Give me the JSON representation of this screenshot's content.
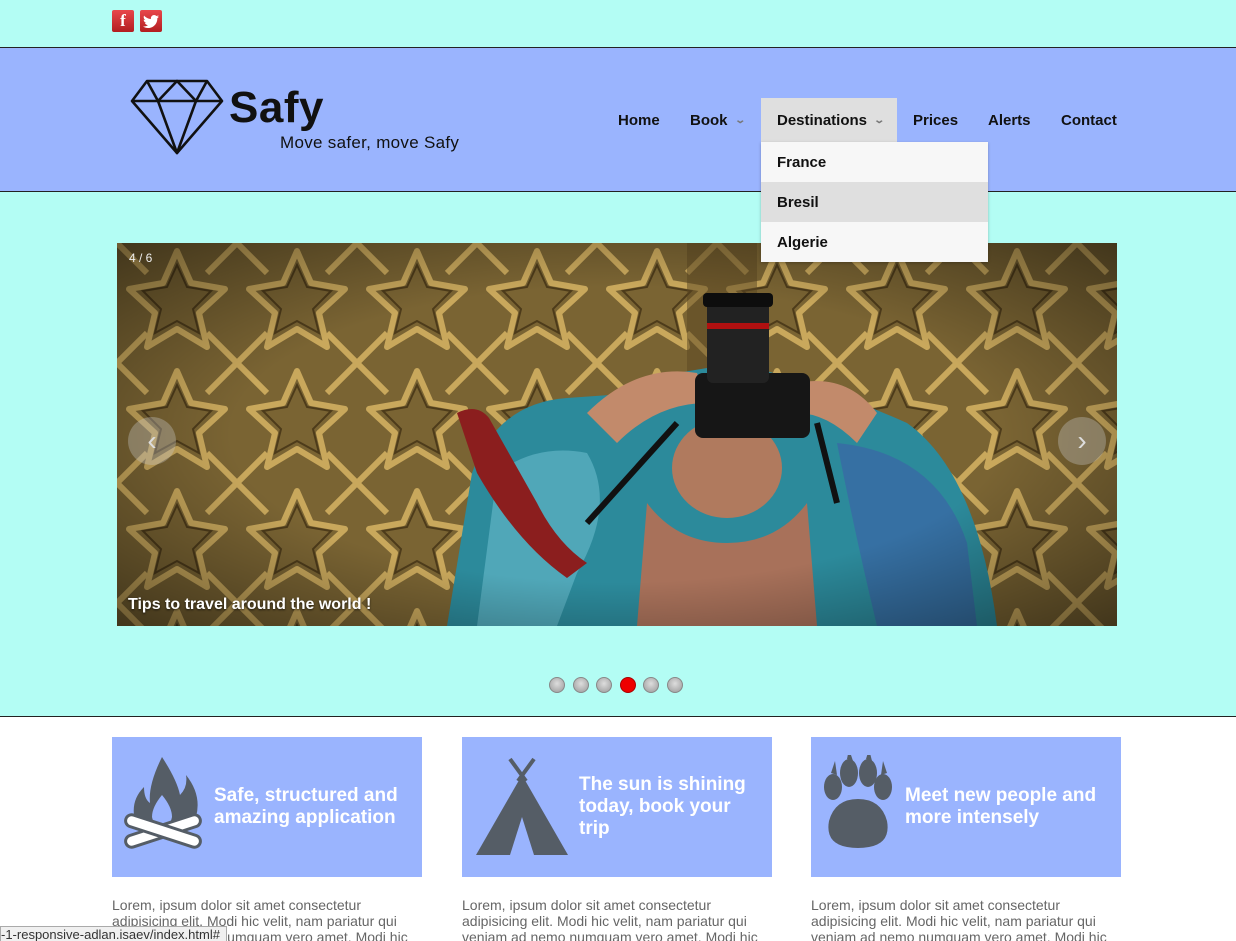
{
  "social": {
    "facebook_glyph": "f",
    "twitter_glyph": "🐦"
  },
  "header": {
    "brand": "Safy",
    "tagline": "Move safer, move Safy",
    "logo_icon": "diamond-icon"
  },
  "nav": {
    "items": [
      {
        "label": "Home",
        "has_dropdown": false
      },
      {
        "label": "Book",
        "has_dropdown": true
      },
      {
        "label": "Destinations",
        "has_dropdown": true,
        "active": true
      },
      {
        "label": "Prices",
        "has_dropdown": false
      },
      {
        "label": "Alerts",
        "has_dropdown": false
      },
      {
        "label": "Contact",
        "has_dropdown": false
      }
    ],
    "dropdown_chevron": "⌄",
    "destinations_menu": [
      "France",
      "Bresil",
      "Algerie"
    ],
    "hovered_item": "Bresil"
  },
  "slider": {
    "counter": "4 / 6",
    "caption": "Tips to travel around the world !",
    "prev_glyph": "‹",
    "next_glyph": "›",
    "total_slides": 6,
    "active_slide": 4
  },
  "features": [
    {
      "icon": "campfire-icon",
      "title": "Safe, structured and amazing application",
      "text": "Lorem, ipsum dolor sit amet consectetur adipisicing elit. Modi hic velit, nam pariatur qui veniam ad nemo numquam vero amet. Modi hic"
    },
    {
      "icon": "tent-icon",
      "title": "The sun is shining today, book your trip",
      "text": "Lorem, ipsum dolor sit amet consectetur adipisicing elit. Modi hic velit, nam pariatur qui veniam ad nemo numquam vero amet. Modi hic"
    },
    {
      "icon": "paw-icon",
      "title": "Meet new people and more intensely",
      "text": "Lorem, ipsum dolor sit amet consectetur adipisicing elit. Modi hic velit, nam pariatur qui veniam ad nemo numquam vero amet. Modi hic"
    }
  ],
  "status_url": "-1-responsive-adlan.isaev/index.html#",
  "colors": {
    "aqua": "#b3fdf4",
    "periwinkle": "#9ab4fe",
    "active_dot": "#ee0000",
    "social_red": "#d32f2f"
  }
}
